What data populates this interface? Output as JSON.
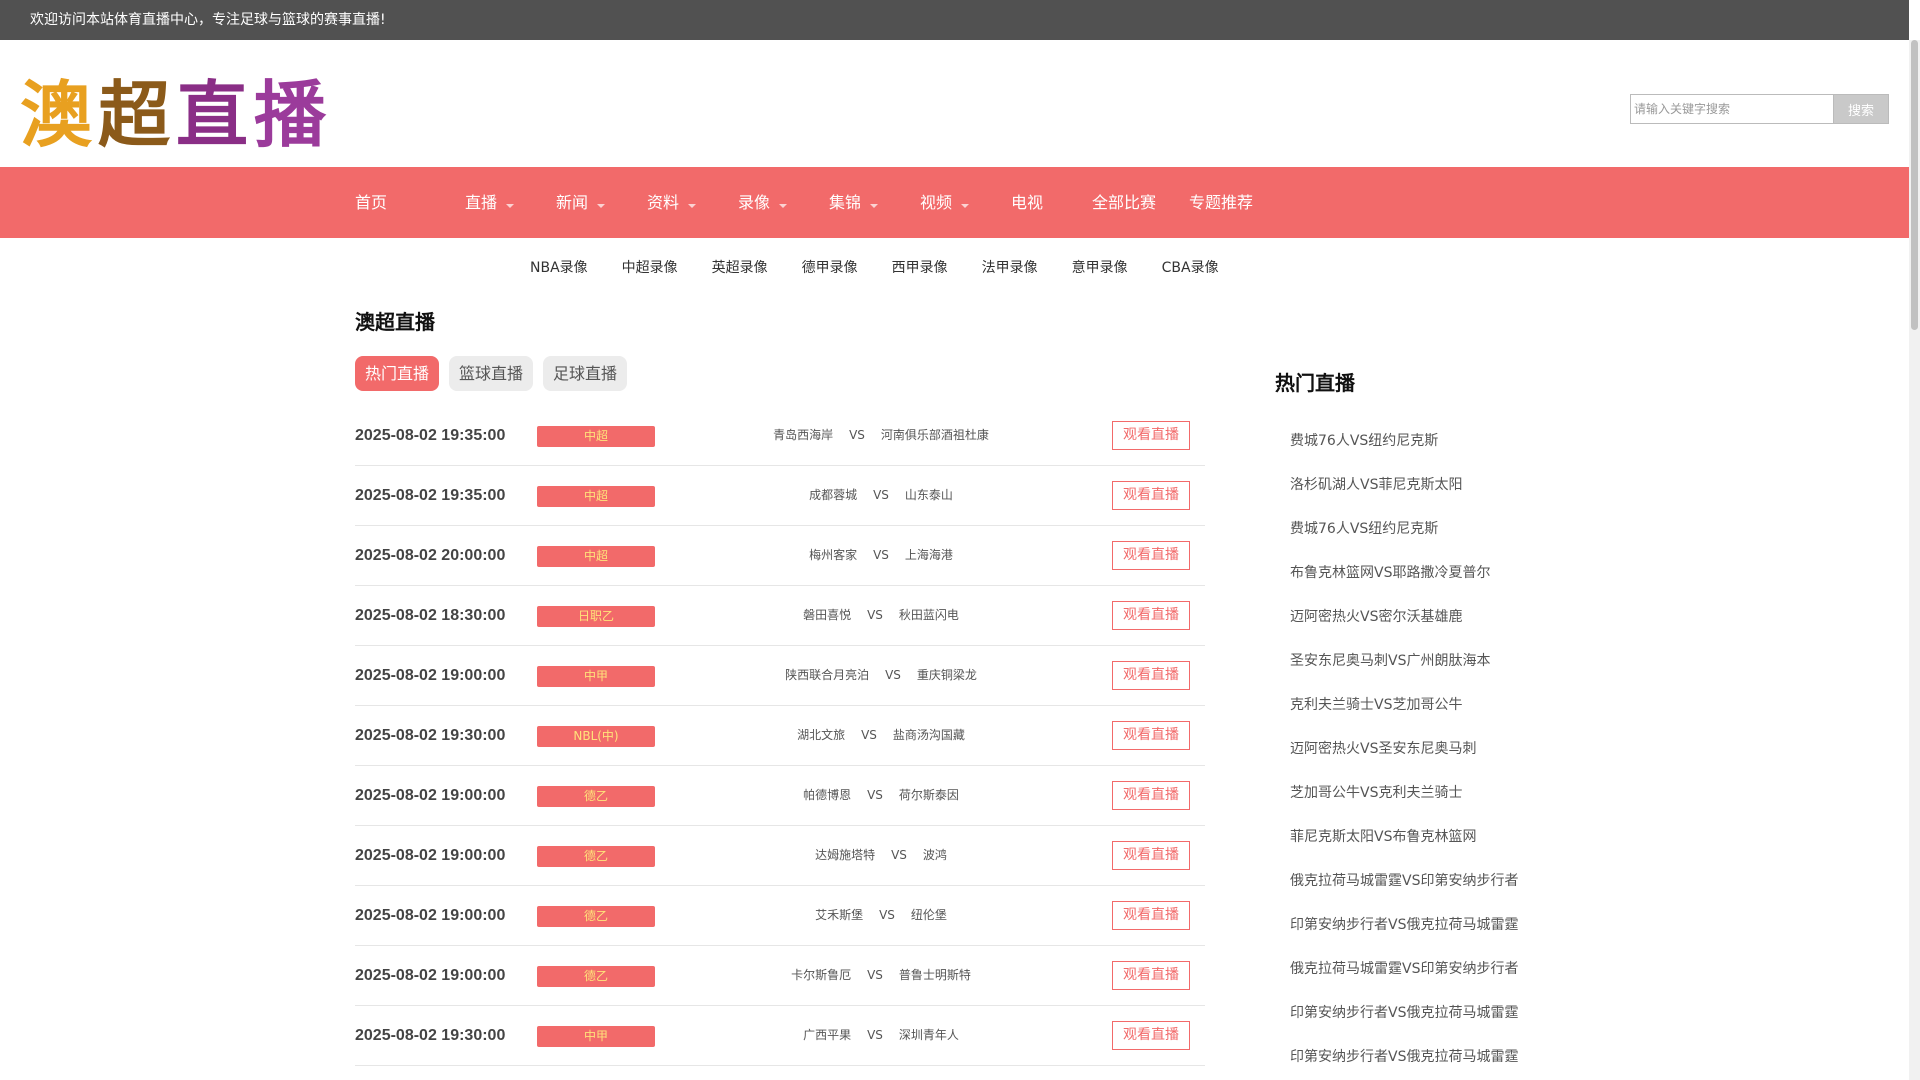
{
  "topbar": {
    "welcome": "欢迎访问本站体育直播中心，专注足球与篮球的赛事直播!"
  },
  "header": {
    "logo_text": "澳超直播",
    "search": {
      "placeholder": "请输入关键字搜索",
      "value": "",
      "button_label": "搜索"
    }
  },
  "nav": {
    "items": [
      {
        "label": "首页",
        "has_dropdown": false
      },
      {
        "label": "直播",
        "has_dropdown": true
      },
      {
        "label": "新闻",
        "has_dropdown": true
      },
      {
        "label": "资料",
        "has_dropdown": true
      },
      {
        "label": "录像",
        "has_dropdown": true
      },
      {
        "label": "集锦",
        "has_dropdown": true
      },
      {
        "label": "视频",
        "has_dropdown": true
      },
      {
        "label": "电视",
        "has_dropdown": false
      },
      {
        "label": "全部比赛",
        "has_dropdown": false
      },
      {
        "label": "专题推荐",
        "has_dropdown": false
      }
    ]
  },
  "subnav": {
    "items": [
      "NBA录像",
      "中超录像",
      "英超录像",
      "德甲录像",
      "西甲录像",
      "法甲录像",
      "意甲录像",
      "CBA录像"
    ]
  },
  "main": {
    "title": "澳超直播",
    "tabs": [
      {
        "label": "热门直播",
        "active": true
      },
      {
        "label": "篮球直播",
        "active": false
      },
      {
        "label": "足球直播",
        "active": false
      }
    ],
    "vs_label": "VS",
    "watch_label": "观看直播",
    "matches": [
      {
        "time": "2025-08-02 19:35:00",
        "league": "中超",
        "home": "青岛西海岸",
        "away": "河南俱乐部酒祖杜康"
      },
      {
        "time": "2025-08-02 19:35:00",
        "league": "中超",
        "home": "成都蓉城",
        "away": "山东泰山"
      },
      {
        "time": "2025-08-02 20:00:00",
        "league": "中超",
        "home": "梅州客家",
        "away": "上海海港"
      },
      {
        "time": "2025-08-02 18:30:00",
        "league": "日职乙",
        "home": "磐田喜悦",
        "away": "秋田蓝闪电"
      },
      {
        "time": "2025-08-02 19:00:00",
        "league": "中甲",
        "home": "陕西联合月亮泊",
        "away": "重庆铜梁龙"
      },
      {
        "time": "2025-08-02 19:30:00",
        "league": "NBL(中)",
        "home": "湖北文旅",
        "away": "盐商汤沟国藏"
      },
      {
        "time": "2025-08-02 19:00:00",
        "league": "德乙",
        "home": "帕德博恩",
        "away": "荷尔斯泰因"
      },
      {
        "time": "2025-08-02 19:00:00",
        "league": "德乙",
        "home": "达姆施塔特",
        "away": "波鸿"
      },
      {
        "time": "2025-08-02 19:00:00",
        "league": "德乙",
        "home": "艾禾斯堡",
        "away": "纽伦堡"
      },
      {
        "time": "2025-08-02 19:00:00",
        "league": "德乙",
        "home": "卡尔斯鲁厄",
        "away": "普鲁士明斯特"
      },
      {
        "time": "2025-08-02 19:30:00",
        "league": "中甲",
        "home": "广西平果",
        "away": "深圳青年人"
      }
    ]
  },
  "sidebar": {
    "title": "热门直播",
    "items": [
      "费城76人VS纽约尼克斯",
      "洛杉矶湖人VS菲尼克斯太阳",
      "费城76人VS纽约尼克斯",
      "布鲁克林篮网VS耶路撒冷夏普尔",
      "迈阿密热火VS密尔沃基雄鹿",
      "圣安东尼奥马刺VS广州朗肽海本",
      "克利夫兰骑士VS芝加哥公牛",
      "迈阿密热火VS圣安东尼奥马刺",
      "芝加哥公牛VS克利夫兰骑士",
      "菲尼克斯太阳VS布鲁克林篮网",
      "俄克拉荷马城雷霆VS印第安纳步行者",
      "印第安纳步行者VS俄克拉荷马城雷霆",
      "俄克拉荷马城雷霆VS印第安纳步行者",
      "印第安纳步行者VS俄克拉荷马城雷霆",
      "印第安纳步行者VS俄克拉荷马城雷霆"
    ]
  },
  "colors": {
    "topbar": "#515151",
    "nav": "#f26a6a",
    "accent": "#f26a6a",
    "league_text": "#ffe37a",
    "logo_chars": [
      "#e8a020",
      "#8b5a1a",
      "#8a2e86",
      "#9b3b9b"
    ]
  }
}
